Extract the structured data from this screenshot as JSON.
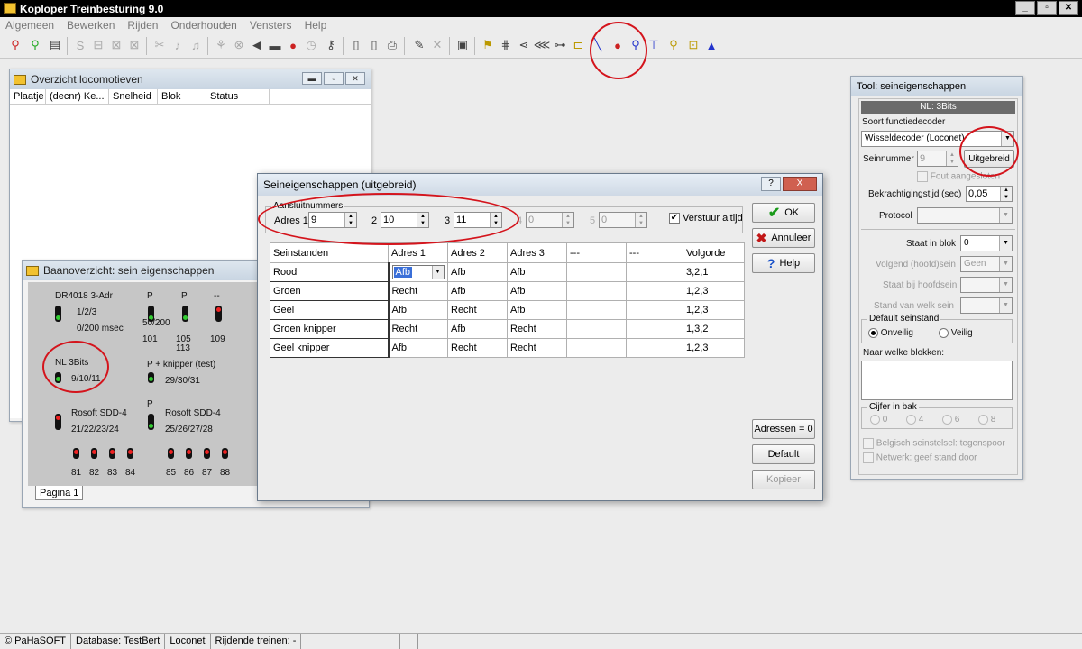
{
  "app": {
    "title": "Koploper Treinbesturing 9.0"
  },
  "menu": [
    "Algemeen",
    "Bewerken",
    "Rijden",
    "Onderhouden",
    "Vensters",
    "Help"
  ],
  "locwin": {
    "title": "Overzicht locomotieven",
    "columns": [
      "Plaatje",
      "(decnr) Ke...",
      "Snelheid",
      "Blok",
      "Status"
    ]
  },
  "baan": {
    "title": "Baanoverzicht: sein eigenschappen",
    "tab": "Pagina 1",
    "signals": [
      {
        "name": "DR4018 3-Adr",
        "addr": "1/2/3",
        "extra": "0/200 msec"
      },
      {
        "name": "P",
        "addr": "50/200",
        "num": "101"
      },
      {
        "name": "P",
        "addr": "105",
        "num": "113"
      },
      {
        "name": "--",
        "num": "109"
      },
      {
        "name": "NL 3Bits",
        "addr": "9/10/11"
      },
      {
        "name": "P + knipper (test)",
        "addr": "29/30/31"
      },
      {
        "name": "Rosoft SDD-4",
        "addr": "21/22/23/24"
      },
      {
        "name": "P",
        "extra": ""
      },
      {
        "name": "Rosoft SDD-4",
        "addr": "25/26/27/28"
      }
    ],
    "row_nums_left": [
      "81",
      "82",
      "83",
      "84"
    ],
    "row_nums_right": [
      "85",
      "86",
      "87",
      "88"
    ]
  },
  "dialog": {
    "title": "Seineigenschappen (uitgebreid)",
    "help_symbol": "?",
    "close_symbol": "X",
    "group_label": "Aansluitnummers",
    "addr1_label": "Adres 1",
    "addr1": "9",
    "addr2_label": "2",
    "addr2": "10",
    "addr3_label": "3",
    "addr3": "11",
    "addr4_label": "4",
    "addr4": "0",
    "addr5_label": "5",
    "addr5": "0",
    "send_always": "Verstuur altijd",
    "table_header": [
      "Seinstanden",
      "Adres 1",
      "Adres 2",
      "Adres 3",
      "---",
      "---",
      "Volgorde"
    ],
    "rows": [
      [
        "Rood",
        "Afb",
        "Afb",
        "Afb",
        "",
        "",
        "3,2,1"
      ],
      [
        "Groen",
        "Recht",
        "Afb",
        "Afb",
        "",
        "",
        "1,2,3"
      ],
      [
        "Geel",
        "Afb",
        "Recht",
        "Afb",
        "",
        "",
        "1,2,3"
      ],
      [
        "Groen knipper",
        "Recht",
        "Afb",
        "Recht",
        "",
        "",
        "1,3,2"
      ],
      [
        "Geel knipper",
        "Afb",
        "Recht",
        "Recht",
        "",
        "",
        "1,2,3"
      ]
    ],
    "btn_ok": "OK",
    "btn_cancel": "Annuleer",
    "btn_help": "Help",
    "btn_addresses": "Adressen = 0",
    "btn_default": "Default",
    "btn_copy": "Kopieer"
  },
  "tool": {
    "title": "Tool: seineigenschappen",
    "header": "NL: 3Bits",
    "decoder_type_label": "Soort functiedecoder",
    "decoder_type": "Wisseldecoder (Loconet)",
    "sign_number_label": "Seinnummer",
    "sign_number": "9",
    "btn_extended": "Uitgebreid",
    "wrong_connected": "Fout aangesloten",
    "energize_label": "Bekrachtigingstijd (sec)",
    "energize": "0,05",
    "protocol_label": "Protocol",
    "protocol": "",
    "block_label": "Staat in blok",
    "block": "0",
    "next_label": "Volgend (hoofd)sein",
    "next": "Geen",
    "main_label": "Staat bij hoofdsein",
    "main": "",
    "position_label": "Stand van welk sein",
    "position": "",
    "default_group": "Default seinstand",
    "unsafe": "Onveilig",
    "safe": "Veilig",
    "blocks_label": "Naar welke blokken:",
    "digits_group": "Cijfer in bak",
    "digits": [
      "0",
      "4",
      "6",
      "8"
    ],
    "belgian": "Belgisch seinstelsel: tegenspoor",
    "network": "Netwerk: geef stand door"
  },
  "status": [
    "© PaHaSOFT",
    "Database: TestBert",
    "Loconet",
    "Rijdende treinen: -",
    "",
    "",
    ""
  ],
  "colors": {
    "annotation": "#d4141c",
    "signal_green": "#33cc33",
    "signal_red": "#ee2222"
  }
}
